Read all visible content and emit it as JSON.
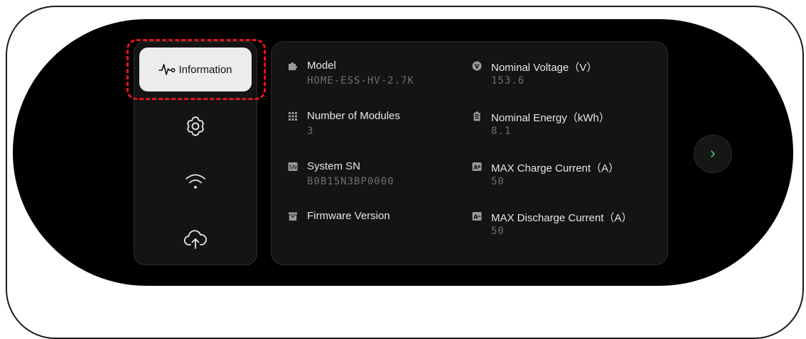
{
  "nav": {
    "active_label": "Information",
    "items": [
      {
        "name": "settings",
        "icon": "gear-icon"
      },
      {
        "name": "wifi",
        "icon": "wifi-icon"
      },
      {
        "name": "upload",
        "icon": "cloud-upload-icon"
      }
    ]
  },
  "info": {
    "model": {
      "label": "Model",
      "value": "HOME-ESS-HV-2.7K"
    },
    "modules": {
      "label": "Number of Modules",
      "value": "3"
    },
    "sn": {
      "label": "System SN",
      "value": "B0B15N3BP0000"
    },
    "firmware": {
      "label": "Firmware Version",
      "value": ""
    },
    "voltage": {
      "label": "Nominal Voltage（V）",
      "value": "153.6"
    },
    "energy": {
      "label": "Nominal Energy（kWh）",
      "value": "8.1"
    },
    "charge": {
      "label": "MAX Charge Current（A）",
      "value": "50"
    },
    "discharge": {
      "label": "MAX Discharge Current（A）",
      "value": "50"
    }
  },
  "colors": {
    "highlight": "#e4161b",
    "accent_green": "#3ec46d"
  }
}
